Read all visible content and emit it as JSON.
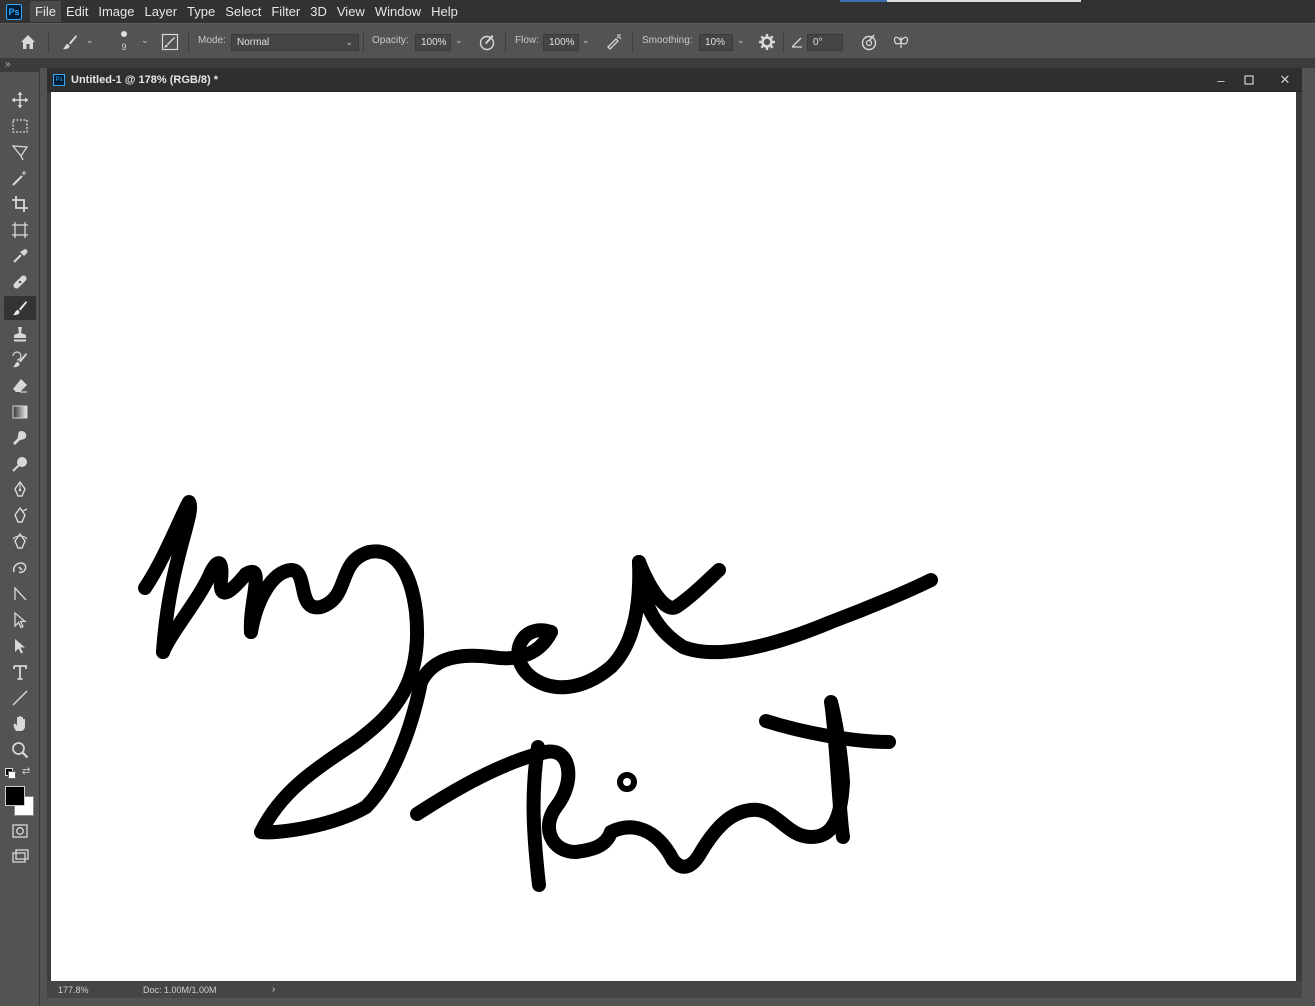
{
  "menu": {
    "items": [
      {
        "label": "File"
      },
      {
        "label": "Edit"
      },
      {
        "label": "Image"
      },
      {
        "label": "Layer"
      },
      {
        "label": "Type"
      },
      {
        "label": "Select"
      },
      {
        "label": "Filter"
      },
      {
        "label": "3D"
      },
      {
        "label": "View"
      },
      {
        "label": "Window"
      },
      {
        "label": "Help"
      }
    ],
    "logo_text": "Ps"
  },
  "options": {
    "brush_size": "9",
    "mode_label": "Mode:",
    "mode_value": "Normal",
    "opacity_label": "Opacity:",
    "opacity_value": "100%",
    "flow_label": "Flow:",
    "flow_value": "100%",
    "smoothing_label": "Smoothing:",
    "smoothing_value": "10%",
    "angle_value": "0°"
  },
  "document": {
    "title": "Untitled-1 @ 178% (RGB/8) *",
    "zoom": "177.8%",
    "doc_size": "Doc: 1.00M/1.00M",
    "canvas_text": "Finger Paint"
  },
  "colors": {
    "foreground": "#000000",
    "background": "#ffffff",
    "accent": "#31a8ff"
  }
}
